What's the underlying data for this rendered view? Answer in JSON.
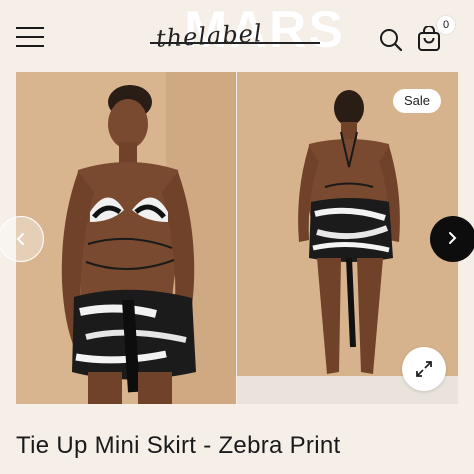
{
  "brand": {
    "name": "MARS",
    "tagline": "thelabel"
  },
  "header": {
    "menu_icon": "hamburger-menu-icon",
    "search_icon": "search-icon",
    "cart_icon": "shopping-bag-icon",
    "cart_count": "0"
  },
  "gallery": {
    "badge": "Sale",
    "prev_icon": "chevron-left-icon",
    "next_icon": "chevron-right-icon",
    "zoom_icon": "expand-icon"
  },
  "product": {
    "title": "Tie Up Mini Skirt - Zebra Print"
  },
  "colors": {
    "background": "#f5efe8",
    "accent": "#0d0d0d",
    "photo_bg": "#d8b58f"
  }
}
